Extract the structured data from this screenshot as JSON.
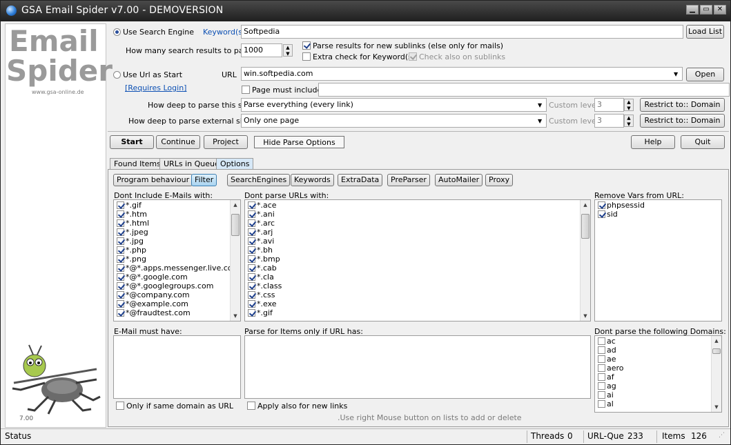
{
  "window": {
    "title": "GSA Email Spider v7.00 - DEMOVERSION"
  },
  "sidebar": {
    "logo_line1": "Email",
    "logo_line2": "Spider",
    "url": "www.gsa-online.de",
    "version": "7.00"
  },
  "search": {
    "use_search_engine_label": "Use Search Engine",
    "keywords_link": "Keyword(s)",
    "keyword_value": "Softpedia",
    "load_list": "Load List",
    "results_label": "How many search results to parse",
    "results_value": "1000",
    "parse_sublinks_label": "Parse results for new sublinks (else only for mails)",
    "extra_check_label": "Extra check for Keyword(s)",
    "check_sublinks_label": "Check also on sublinks"
  },
  "url": {
    "use_url_label": "Use Url as Start",
    "url_label": "URL",
    "url_value": "win.softpedia.com",
    "open": "Open",
    "requires_login": "[Requires Login]",
    "page_must_include": "Page must include",
    "deep_site_label": "How deep to parse this site",
    "deep_site_value": "Parse everything (every link)",
    "custom_level": "Custom level",
    "level_value_1": "3",
    "restrict": "Restrict to:: Domain",
    "deep_ext_label": "How deep to parse external sites",
    "deep_ext_value": "Only one page",
    "level_value_2": "3"
  },
  "actions": {
    "start": "Start",
    "continue": "Continue",
    "project": "Project",
    "hide_parse": "Hide Parse Options",
    "help": "Help",
    "quit": "Quit"
  },
  "tabs": [
    "Found Items",
    "URLs in Queue",
    "Options"
  ],
  "subtabs": [
    "Program behaviour",
    "Filter",
    "SearchEngines",
    "Keywords",
    "ExtraData",
    "PreParser",
    "AutoMailer",
    "Proxy"
  ],
  "filters": {
    "dont_include_label": "Dont Include E-Mails with:",
    "dont_include": [
      "*.gif",
      "*.htm",
      "*.html",
      "*.jpeg",
      "*.jpg",
      "*.php",
      "*.png",
      "*@*.apps.messenger.live.com",
      "*@*.google.com",
      "*@*.googlegroups.com",
      "*@company.com",
      "*@example.com",
      "*@fraudtest.com"
    ],
    "dont_parse_label": "Dont parse URLs with:",
    "dont_parse": [
      "*.ace",
      "*.ani",
      "*.arc",
      "*.arj",
      "*.avi",
      "*.bh",
      "*.bmp",
      "*.cab",
      "*.cla",
      "*.class",
      "*.css",
      "*.exe",
      "*.gif"
    ],
    "remove_vars_label": "Remove Vars from URL:",
    "remove_vars": [
      "phpsessid",
      "sid"
    ],
    "email_must_have_label": "E-Mail must have:",
    "parse_items_label": "Parse for Items only if URL has:",
    "dont_parse_domains_label": "Dont parse the following Domains:",
    "domains": [
      "ac",
      "ad",
      "ae",
      "aero",
      "af",
      "ag",
      "ai",
      "al"
    ],
    "same_domain_label": "Only if same domain as URL",
    "apply_new_links_label": "Apply also for new links",
    "hint": ".Use right Mouse button on lists to add or delete"
  },
  "status": {
    "status_label": "Status",
    "threads_label": "Threads",
    "threads_value": "0",
    "urlque_label": "URL-Que",
    "urlque_value": "233",
    "items_label": "Items",
    "items_value": "126"
  }
}
